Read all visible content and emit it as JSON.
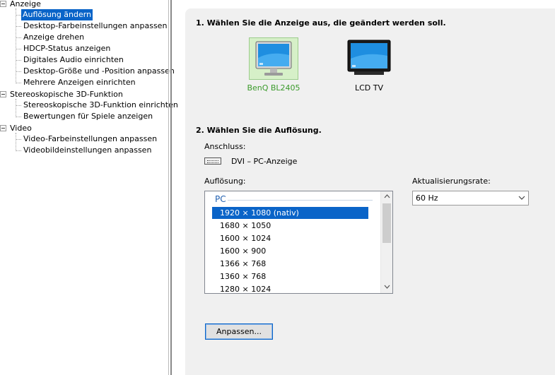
{
  "tree": {
    "categories": [
      {
        "label": "Anzeige",
        "items": [
          "Auflösung ändern",
          "Desktop-Farbeinstellungen anpassen",
          "Anzeige drehen",
          "HDCP-Status anzeigen",
          "Digitales Audio einrichten",
          "Desktop-Größe und -Position anpassen",
          "Mehrere Anzeigen einrichten"
        ],
        "selected_index": 0
      },
      {
        "label": "Stereoskopische 3D-Funktion",
        "items": [
          "Stereoskopische 3D-Funktion einrichten",
          "Bewertungen für Spiele anzeigen"
        ]
      },
      {
        "label": "Video",
        "items": [
          "Video-Farbeinstellungen anpassen",
          "Videobildeinstellungen anpassen"
        ]
      }
    ]
  },
  "step1": {
    "title": "1. Wählen Sie die Anzeige aus, die geändert werden soll.",
    "displays": [
      {
        "label": "BenQ BL2405",
        "selected": true,
        "label_color": "#3a9a2a",
        "icon": "monitor-icon"
      },
      {
        "label": "LCD TV",
        "selected": false,
        "icon": "tv-icon"
      }
    ]
  },
  "step2": {
    "title": "2. Wählen Sie die Auflösung.",
    "connection_label": "Anschluss:",
    "connection_icon": "dvi-connector-icon",
    "connection_value": "DVI – PC-Anzeige",
    "resolution_label": "Auflösung:",
    "resolution_group": "PC",
    "resolutions": [
      "1920 × 1080 (nativ)",
      "1680 × 1050",
      "1600 × 1024",
      "1600 × 900",
      "1366 × 768",
      "1360 × 768",
      "1280 × 1024"
    ],
    "selected_resolution_index": 0,
    "refresh_label": "Aktualisierungsrate:",
    "refresh_value": "60 Hz",
    "customize_button": "Anpassen..."
  },
  "colors": {
    "selection": "#0a64c8",
    "panel_bg": "#f0f0f0",
    "selected_display_bg": "#d6f0c8"
  }
}
